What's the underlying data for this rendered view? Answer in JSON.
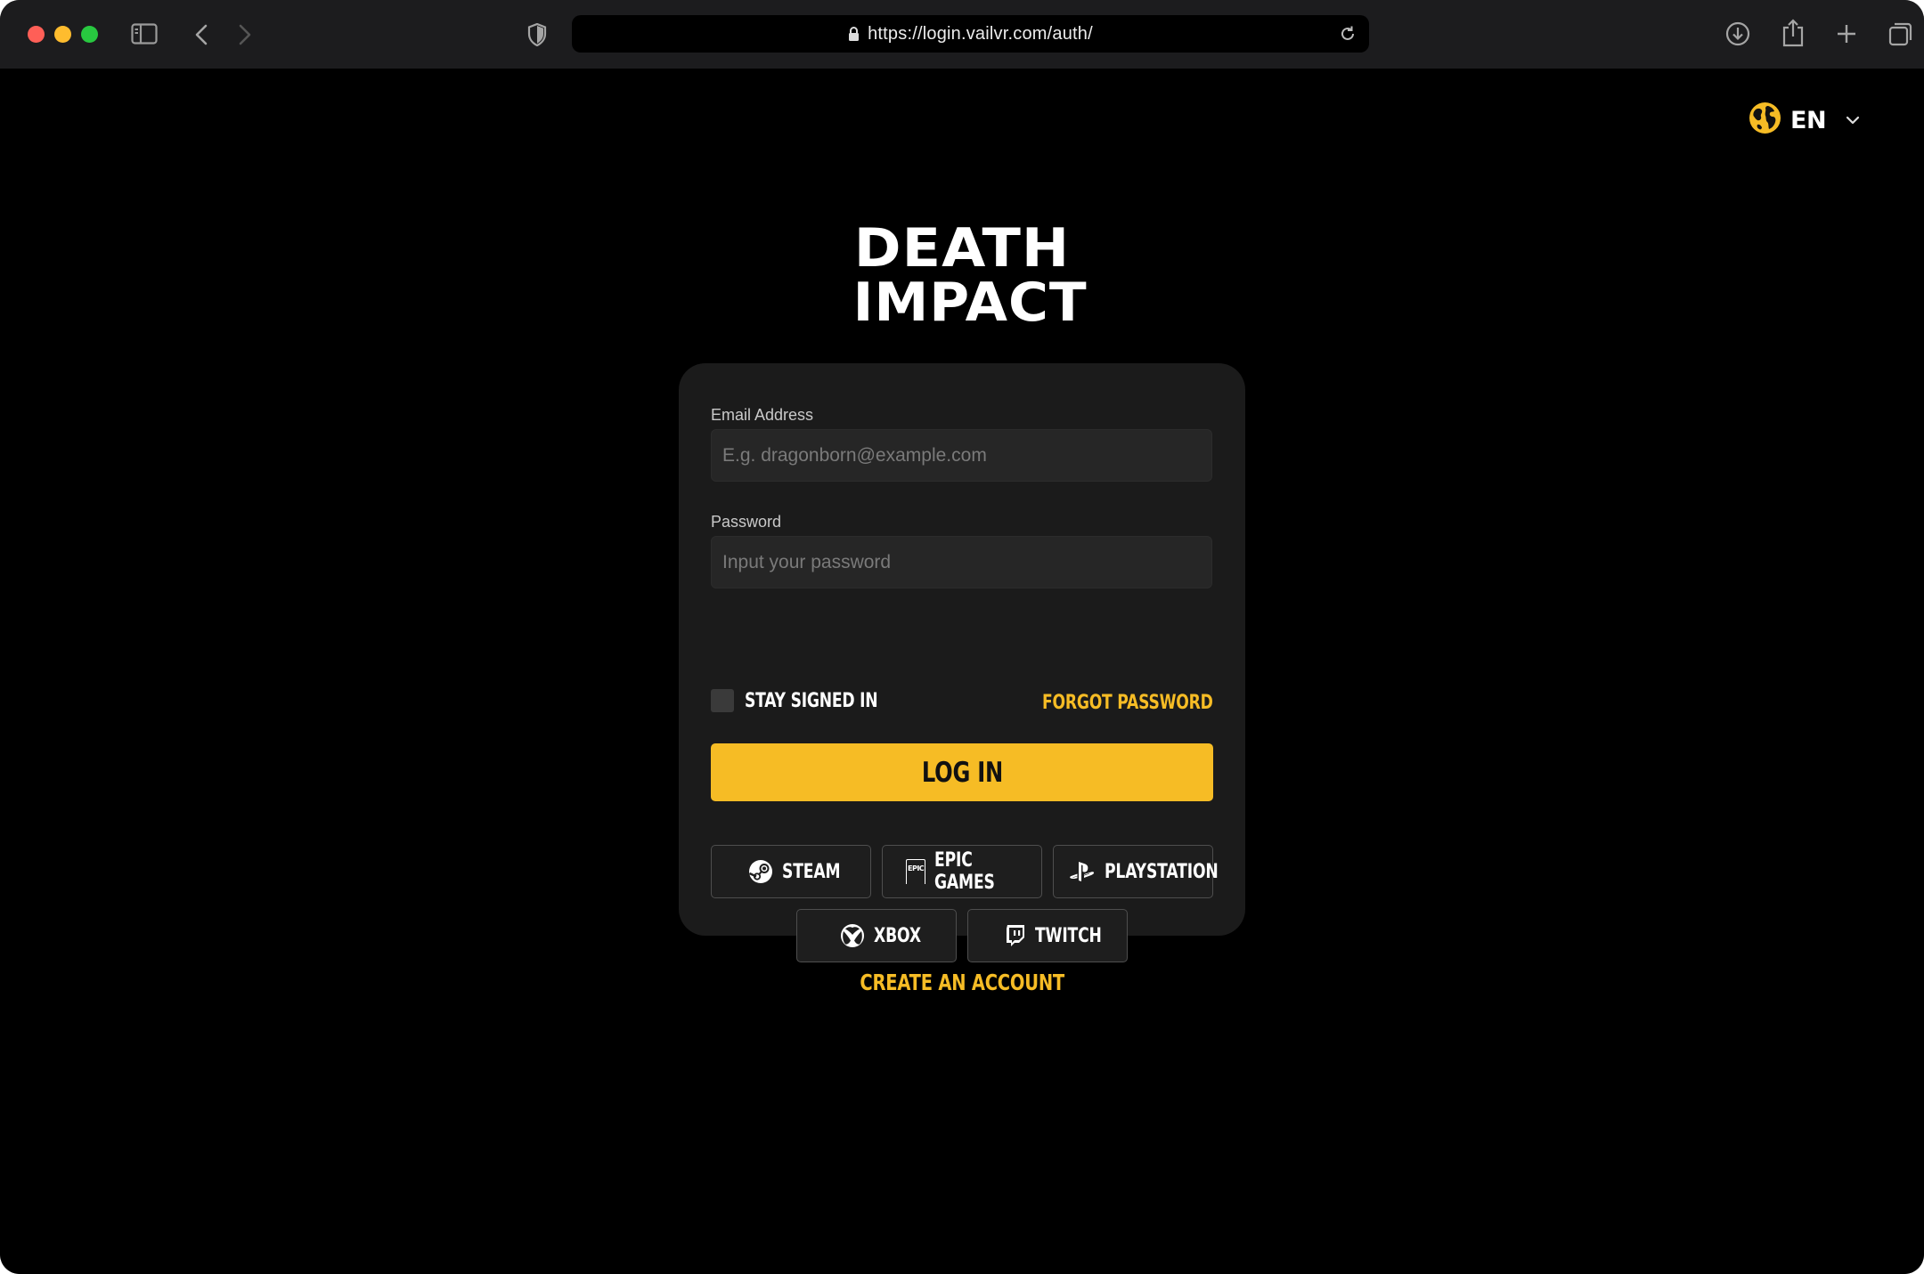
{
  "browser": {
    "url": "https://login.vailvr.com/auth/"
  },
  "language": {
    "code": "EN"
  },
  "logo": {
    "line1": "DEATH",
    "line2": "IMPACT"
  },
  "form": {
    "email_label": "Email Address",
    "email_placeholder": "E.g. dragonborn@example.com",
    "password_label": "Password",
    "password_placeholder": "Input your password",
    "stay_signed_in": "STAY SIGNED IN",
    "forgot_password": "FORGOT PASSWORD",
    "login_button": "LOG IN"
  },
  "social": {
    "steam": "STEAM",
    "epic": "EPIC GAMES",
    "epic_icon_text": "EPIC",
    "playstation": "PLAYSTATION",
    "xbox": "XBOX",
    "twitch": "TWITCH"
  },
  "footer": {
    "create_account": "CREATE AN ACCOUNT"
  },
  "colors": {
    "accent": "#f6bc25",
    "card": "#1b1b1b",
    "background": "#000000"
  }
}
